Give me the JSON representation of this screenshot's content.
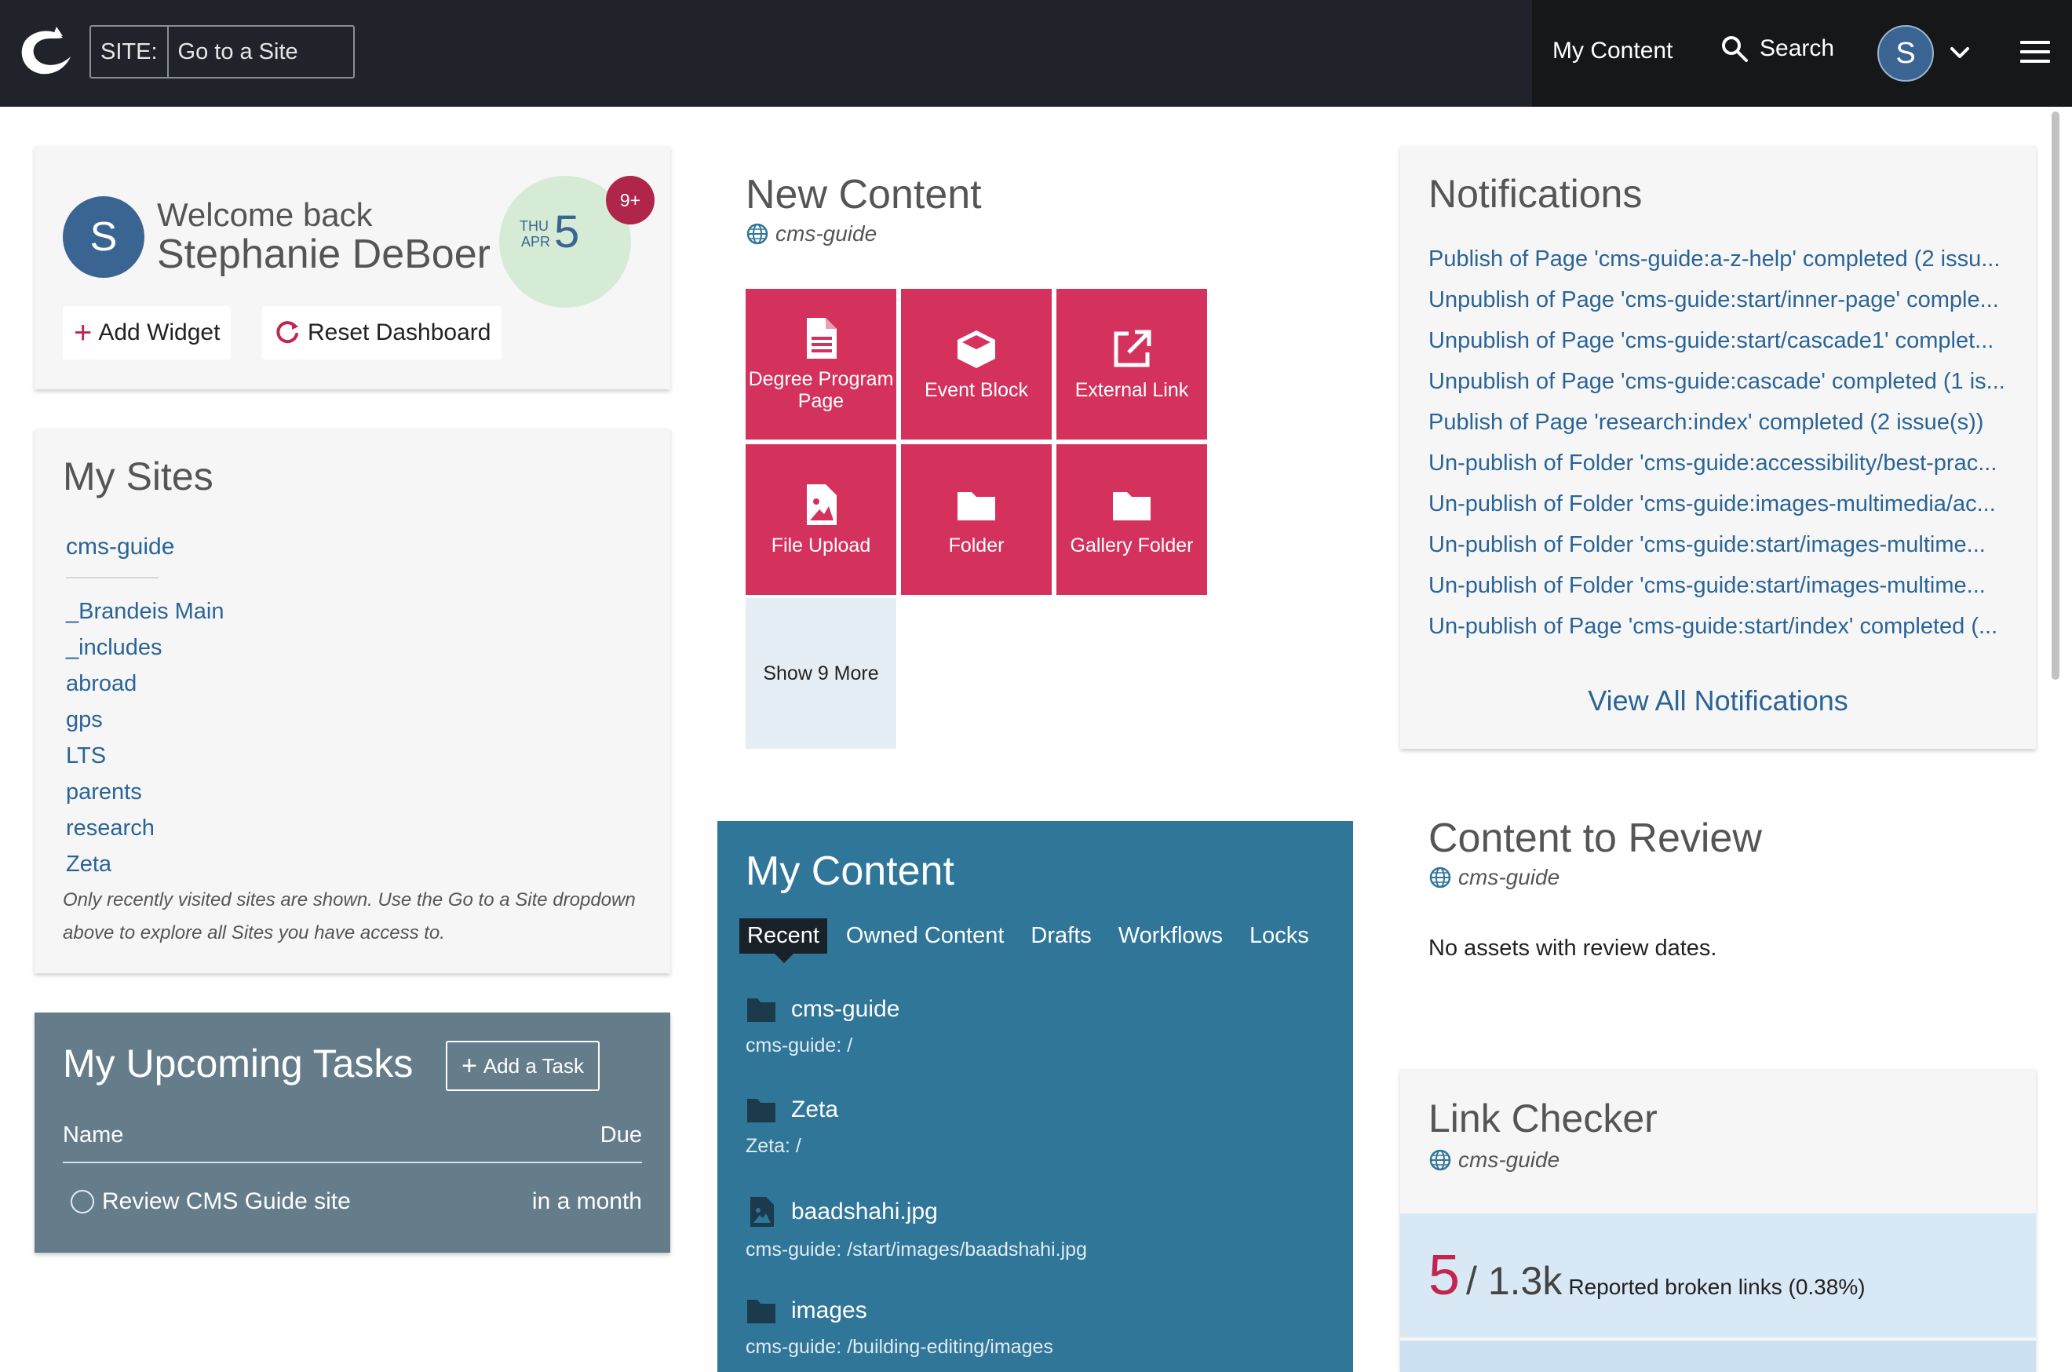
{
  "topbar": {
    "site_label": "SITE:",
    "site_placeholder": "Go to a Site",
    "my_content": "My Content",
    "search": "Search",
    "avatar_initial": "S"
  },
  "welcome": {
    "avatar_initial": "S",
    "greeting": "Welcome back",
    "name": "Stephanie DeBoer",
    "date_dow": "THU",
    "date_month": "APR",
    "date_day": "5",
    "badge": "9+",
    "add_widget": "Add Widget",
    "reset_dashboard": "Reset Dashboard"
  },
  "my_sites": {
    "title": "My Sites",
    "current": "cms-guide",
    "sites": [
      "_Brandeis Main",
      "_includes",
      "abroad",
      "gps",
      "LTS",
      "parents",
      "research",
      "Zeta"
    ],
    "note": "Only recently visited sites are shown. Use the Go to a Site dropdown above to explore all Sites you have access to."
  },
  "tasks": {
    "title": "My Upcoming Tasks",
    "add_task": "Add a Task",
    "col_name": "Name",
    "col_due": "Due",
    "items": [
      {
        "name": "Review CMS Guide site",
        "due": "in a month"
      }
    ]
  },
  "new_content": {
    "title": "New Content",
    "site": "cms-guide",
    "tiles": [
      {
        "label": "Degree Program Page",
        "icon": "document-icon"
      },
      {
        "label": "Event Block",
        "icon": "cube-icon"
      },
      {
        "label": "External Link",
        "icon": "external-link-icon"
      },
      {
        "label": "File Upload",
        "icon": "image-file-icon"
      },
      {
        "label": "Folder",
        "icon": "folder-icon"
      },
      {
        "label": "Gallery Folder",
        "icon": "folder-icon"
      }
    ],
    "show_more": "Show 9 More"
  },
  "my_content": {
    "title": "My Content",
    "tabs": [
      "Recent",
      "Owned Content",
      "Drafts",
      "Workflows",
      "Locks"
    ],
    "active_tab": "Recent",
    "items": [
      {
        "name": "cms-guide",
        "path": "cms-guide: /",
        "icon": "folder-icon"
      },
      {
        "name": "Zeta",
        "path": "Zeta: /",
        "icon": "folder-icon"
      },
      {
        "name": "baadshahi.jpg",
        "path": "cms-guide: /start/images/baadshahi.jpg",
        "icon": "image-file-icon"
      },
      {
        "name": "images",
        "path": "cms-guide: /building-editing/images",
        "icon": "folder-icon"
      }
    ]
  },
  "notifications": {
    "title": "Notifications",
    "items": [
      "Publish of Page 'cms-guide:a-z-help' completed (2 issu...",
      "Unpublish of Page 'cms-guide:start/inner-page' comple...",
      "Unpublish of Page 'cms-guide:start/cascade1' complet...",
      "Unpublish of Page 'cms-guide:cascade' completed (1 is...",
      "Publish of Page 'research:index' completed (2 issue(s))",
      "Un-publish of Folder 'cms-guide:accessibility/best-prac...",
      "Un-publish of Folder 'cms-guide:images-multimedia/ac...",
      "Un-publish of Folder 'cms-guide:start/images-multime...",
      "Un-publish of Folder 'cms-guide:start/images-multime...",
      "Un-publish of Page 'cms-guide:start/index' completed (..."
    ],
    "view_all": "View All Notifications"
  },
  "content_review": {
    "title": "Content to Review",
    "site": "cms-guide",
    "message": "No assets with review dates."
  },
  "link_checker": {
    "title": "Link Checker",
    "site": "cms-guide",
    "broken": "5",
    "total": "/ 1.3k",
    "label": "Reported broken links (0.38%)"
  },
  "colors": {
    "topbar": "#20242a",
    "accent_tile": "#d4325d",
    "my_content_bg": "#2f7699",
    "tasks_bg": "#657d8b",
    "link": "#2a6496",
    "badge": "#b0254a"
  }
}
